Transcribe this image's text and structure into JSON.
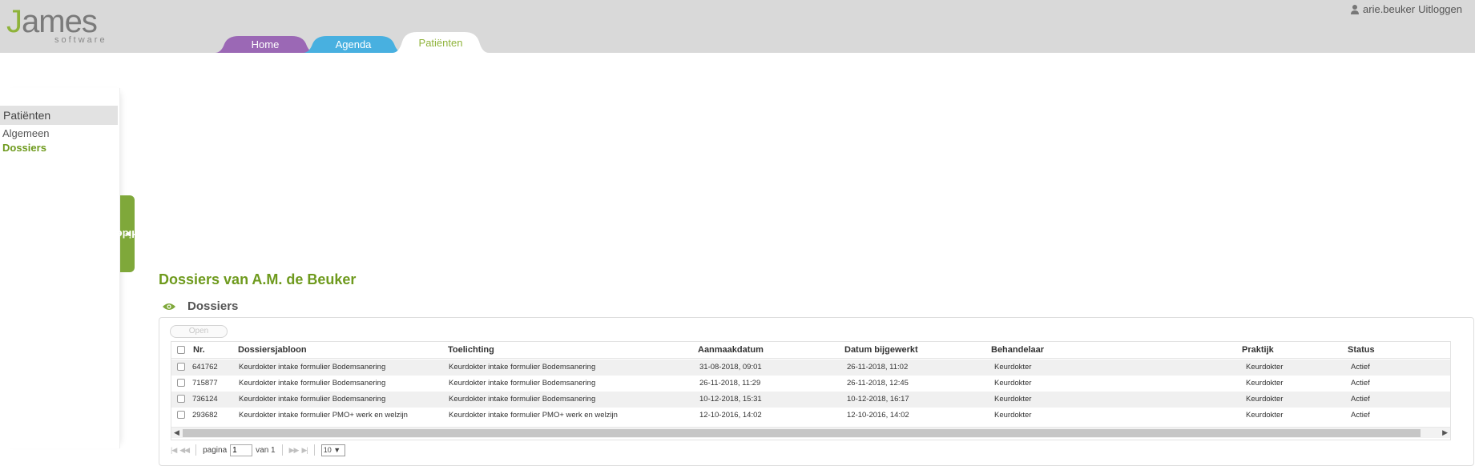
{
  "header": {
    "logo_main": "ames",
    "logo_j": "J",
    "logo_sub": "software",
    "user": "arie.beuker",
    "logout": "Uitloggen"
  },
  "tabs": [
    {
      "label": "Home",
      "color": "#9b68b5"
    },
    {
      "label": "Agenda",
      "color": "#48b0e0"
    },
    {
      "label": "Patiënten",
      "color": "#ffffff",
      "active": true
    }
  ],
  "sidebar": {
    "header": "Patiënten",
    "items": [
      {
        "label": "Algemeen"
      },
      {
        "label": "Dossiers",
        "active": true
      }
    ],
    "hide_label": "Hide"
  },
  "main": {
    "title": "Dossiers van A.M. de Beuker",
    "section_title": "Dossiers",
    "open_button": "Open"
  },
  "grid": {
    "columns": [
      "Nr.",
      "Dossiersjabloon",
      "Toelichting",
      "Aanmaakdatum",
      "Datum bijgewerkt",
      "Behandelaar",
      "Praktijk",
      "Status"
    ],
    "rows": [
      [
        "641762",
        "Keurdokter intake formulier Bodemsanering",
        "Keurdokter intake formulier Bodemsanering",
        "31-08-2018, 09:01",
        "26-11-2018, 11:02",
        "Keurdokter",
        "Keurdokter",
        "Actief"
      ],
      [
        "715877",
        "Keurdokter intake formulier Bodemsanering",
        "Keurdokter intake formulier Bodemsanering",
        "26-11-2018, 11:29",
        "26-11-2018, 12:45",
        "Keurdokter",
        "Keurdokter",
        "Actief"
      ],
      [
        "736124",
        "Keurdokter intake formulier Bodemsanering",
        "Keurdokter intake formulier Bodemsanering",
        "10-12-2018, 15:31",
        "10-12-2018, 16:17",
        "Keurdokter",
        "Keurdokter",
        "Actief"
      ],
      [
        "293682",
        "Keurdokter intake formulier PMO+ werk en welzijn",
        "Keurdokter intake formulier PMO+ werk en welzijn",
        "12-10-2016, 14:02",
        "12-10-2016, 14:02",
        "Keurdokter",
        "Keurdokter",
        "Actief"
      ]
    ]
  },
  "pager": {
    "page_label": "pagina",
    "page_value": "1",
    "of_label": "van 1",
    "page_size": "10 ▼"
  }
}
